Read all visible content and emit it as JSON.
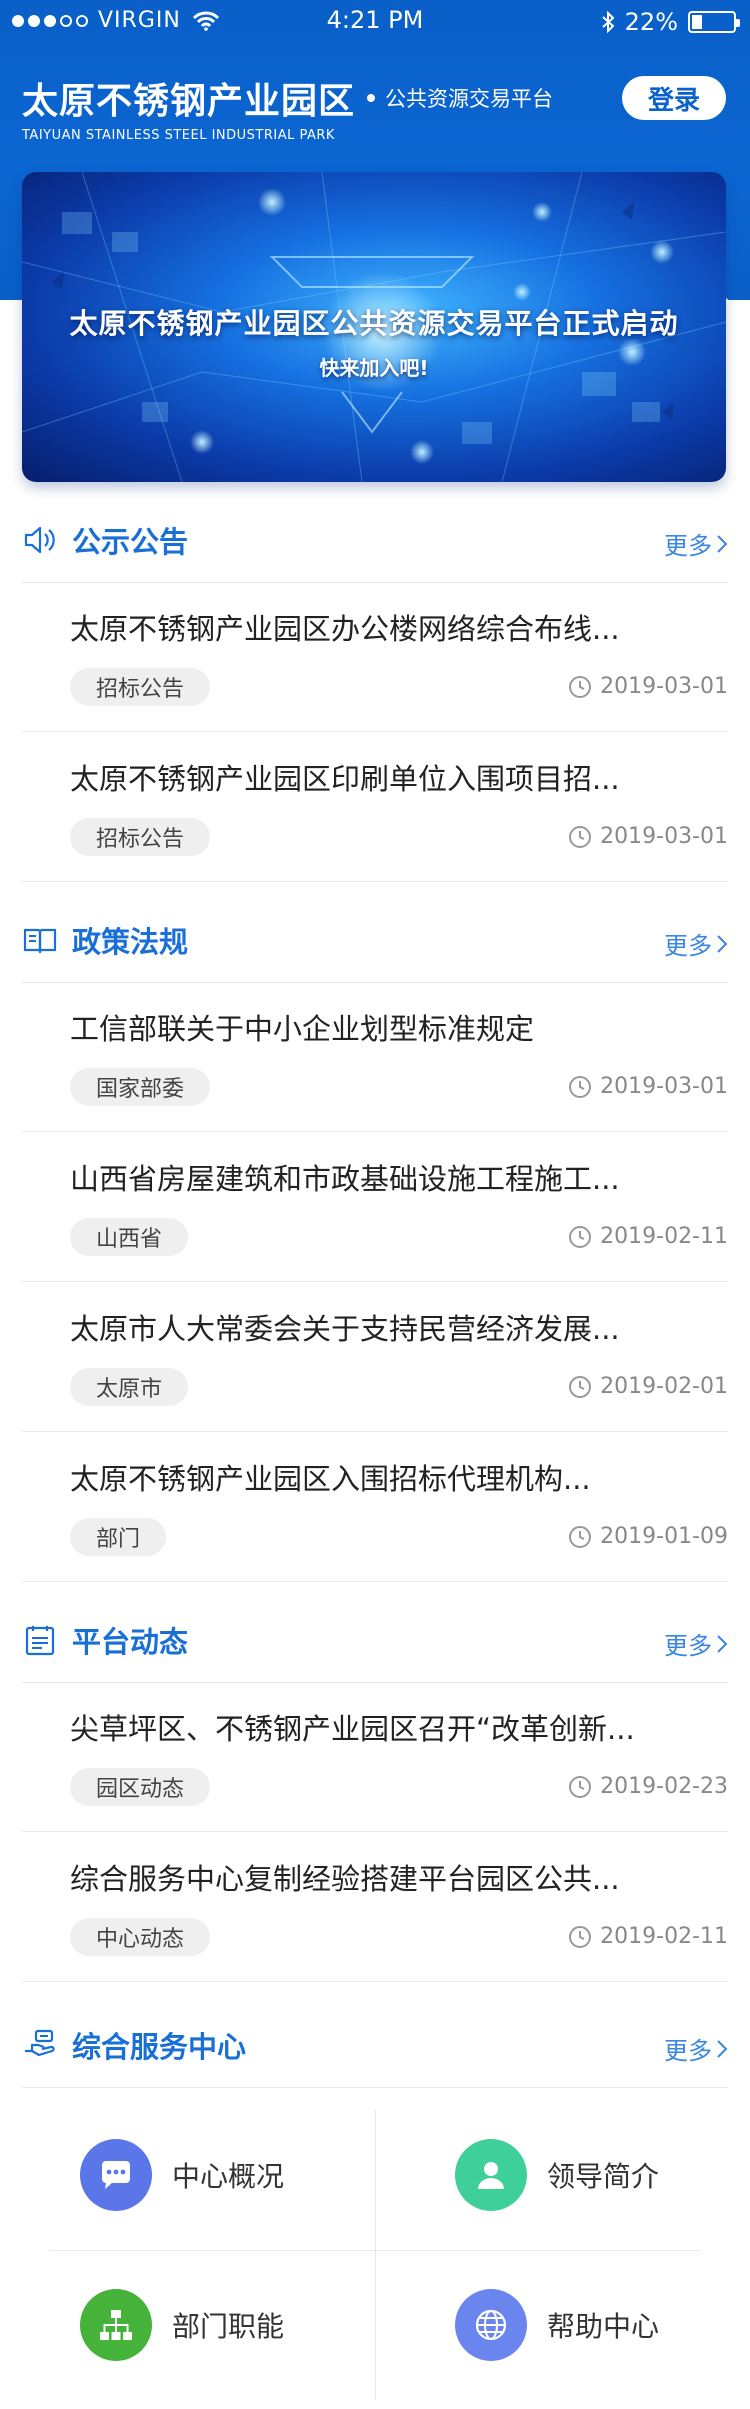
{
  "status_bar": {
    "carrier": "VIRGIN",
    "time": "4:21 PM",
    "battery": "22%"
  },
  "brand": {
    "title": "太原不锈钢产业园区",
    "subtitle": "公共资源交易平台",
    "english": "TAIYUAN STAINLESS STEEL INDUSTRIAL PARK"
  },
  "login_label": "登录",
  "banner": {
    "title": "太原不锈钢产业园区公共资源交易平台正式启动",
    "subtitle": "快来加入吧!"
  },
  "more_label": "更多",
  "sections": {
    "notices": {
      "title": "公示公告",
      "items": [
        {
          "title": "太原不锈钢产业园区办公楼网络综合布线...",
          "tag": "招标公告",
          "date": "2019-03-01"
        },
        {
          "title": "太原不锈钢产业园区印刷单位入围项目招...",
          "tag": "招标公告",
          "date": "2019-03-01"
        }
      ]
    },
    "policies": {
      "title": "政策法规",
      "items": [
        {
          "title": "工信部联关于中小企业划型标准规定",
          "tag": "国家部委",
          "date": "2019-03-01"
        },
        {
          "title": "山西省房屋建筑和市政基础设施工程施工...",
          "tag": "山西省",
          "date": "2019-02-11"
        },
        {
          "title": "太原市人大常委会关于支持民营经济发展...",
          "tag": "太原市",
          "date": "2019-02-01"
        },
        {
          "title": "太原不锈钢产业园区入围招标代理机构...",
          "tag": "部门",
          "date": "2019-01-09"
        }
      ]
    },
    "news": {
      "title": "平台动态",
      "items": [
        {
          "title": "尖草坪区、不锈钢产业园区召开“改革创新...",
          "tag": "园区动态",
          "date": "2019-02-23"
        },
        {
          "title": "综合服务中心复制经验搭建平台园区公共...",
          "tag": "中心动态",
          "date": "2019-02-11"
        }
      ]
    },
    "services": {
      "title": "综合服务中心",
      "items": [
        {
          "label": "中心概况",
          "icon": "chat-bubble-icon",
          "color": "#5b76e8"
        },
        {
          "label": "领导简介",
          "icon": "person-icon",
          "color": "#3fcf9a"
        },
        {
          "label": "部门职能",
          "icon": "org-chart-icon",
          "color": "#45b23a"
        },
        {
          "label": "帮助中心",
          "icon": "globe-icon",
          "color": "#6a86ee"
        }
      ]
    }
  },
  "colors": {
    "primary": "#0b62cc",
    "accent": "#1a6fd6",
    "tag_bg": "#efefef"
  }
}
